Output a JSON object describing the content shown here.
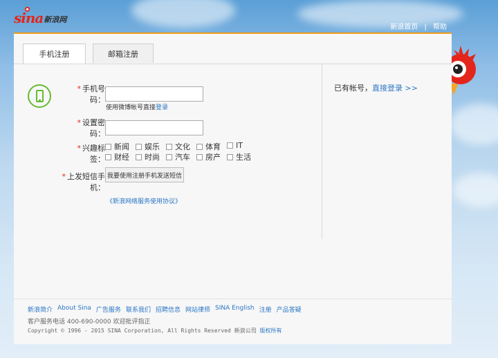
{
  "header": {
    "logo_sina": "sina",
    "logo_cn": "新浪网",
    "links": [
      "新浪首页",
      "帮助"
    ],
    "separator": "|"
  },
  "tabs": [
    {
      "label": "手机注册",
      "active": true
    },
    {
      "label": "邮箱注册",
      "active": false
    }
  ],
  "form": {
    "phone": {
      "star": "*",
      "label": "手机号码：",
      "value": ""
    },
    "phone_hint_prefix": "使用微博帐号直接",
    "phone_hint_link": "登录",
    "password": {
      "star": "*",
      "label": "设置密码：",
      "value": ""
    },
    "interests": {
      "star": "*",
      "label": "兴趣标签：",
      "tags": [
        "新闻",
        "娱乐",
        "文化",
        "体育",
        "IT",
        "财经",
        "时尚",
        "汽车",
        "房产",
        "生活"
      ]
    },
    "sms": {
      "star": "*",
      "label": "上发短信手机：",
      "button": "我要使用注册手机发送短信"
    },
    "agreement": "《新浪网络服务使用协议》"
  },
  "side": {
    "prefix": "已有帐号，",
    "link": "直接登录 >>"
  },
  "footer": {
    "links": [
      "新浪简介",
      "About Sina",
      "广告服务",
      "联系我们",
      "招聘信息",
      "网站律师",
      "SINA English",
      "注册",
      "产品答疑"
    ],
    "service": "客户服务电话 400-690-0000 欢迎批评指正",
    "copyright": "Copyright © 1996 - 2015 SINA Corporation, All Rights Reserved 新浪公司",
    "copyright_link": "版权所有"
  },
  "colors": {
    "accent": "#f39c12",
    "link": "#2a76c6",
    "required": "#e3261b",
    "phone_icon": "#66bb2e"
  }
}
